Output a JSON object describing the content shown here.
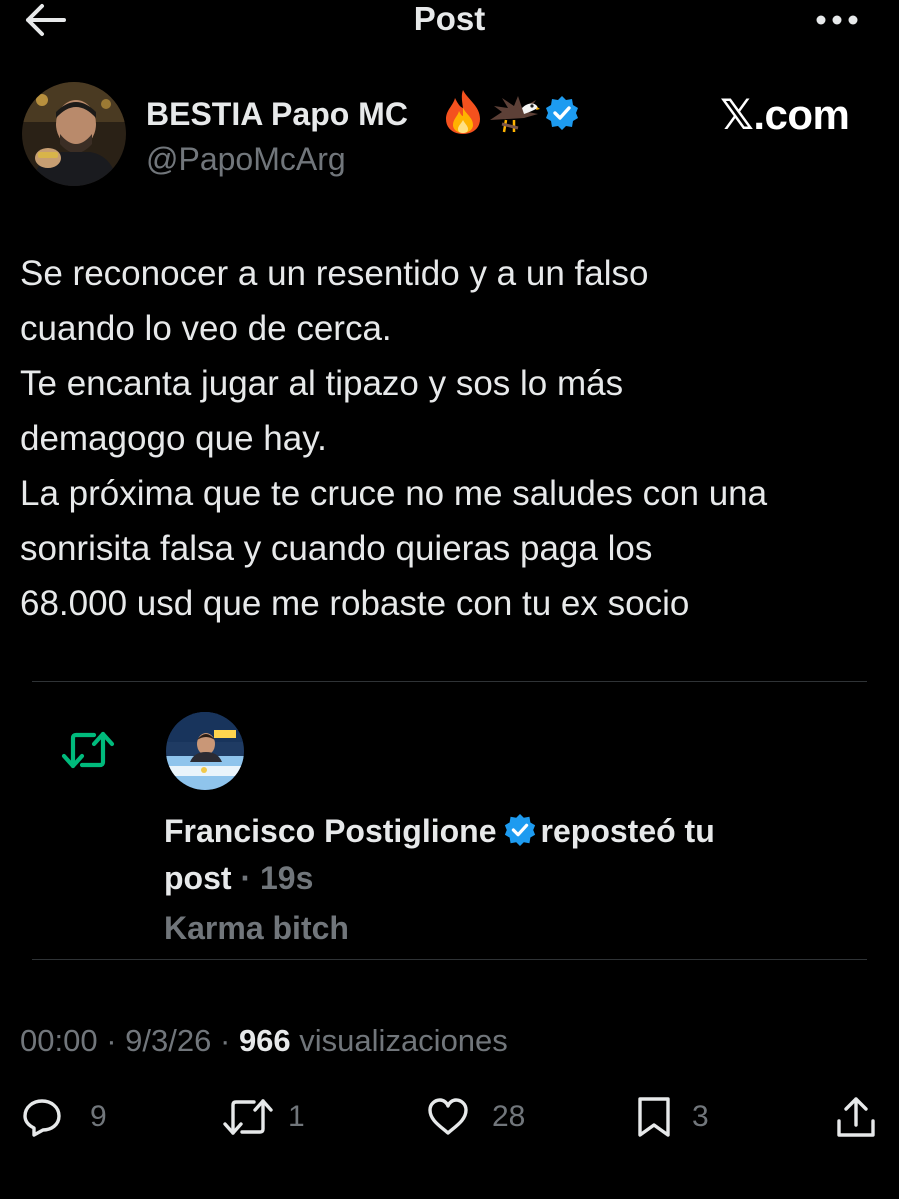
{
  "header": {
    "title": "Post"
  },
  "author": {
    "name": "BESTIA Papo MC",
    "emojis": [
      "fire",
      "eagle"
    ],
    "verified": true,
    "handle": "@PapoMcArg"
  },
  "watermark": {
    "label": "𝕏.com"
  },
  "tweet": {
    "lines": [
      "Se reconocer a un resentido y a un falso",
      "cuando lo veo de cerca.",
      "Te encanta jugar al tipazo y sos lo más",
      "demagogo que hay.",
      "La próxima que te cruce no me saludes con una",
      "sonrisita falsa y cuando quieras paga los",
      "68.000 usd que me robaste con tu ex socio"
    ]
  },
  "repost_card": {
    "icon": "repost-icon",
    "icon_color": "#00ba7c",
    "reposter_name": "Francisco Postiglione",
    "verified": true,
    "action_text_part1": "reposteó tu",
    "action_text_part2": "post",
    "time": "· 19s",
    "comment": "Karma bitch"
  },
  "meta": {
    "time": "00:00",
    "sep1": "·",
    "date": "9/3/26",
    "sep2": "·",
    "views_count": "966",
    "views_label": "visualizaciones"
  },
  "actions": {
    "replies": "9",
    "reposts": "1",
    "likes": "28",
    "bookmarks": "3"
  },
  "colors": {
    "background": "#000000",
    "text": "#e7e9ea",
    "muted": "#71767b",
    "verified": "#1d9bf0",
    "repost_green": "#00ba7c",
    "divider": "#2f3336"
  }
}
